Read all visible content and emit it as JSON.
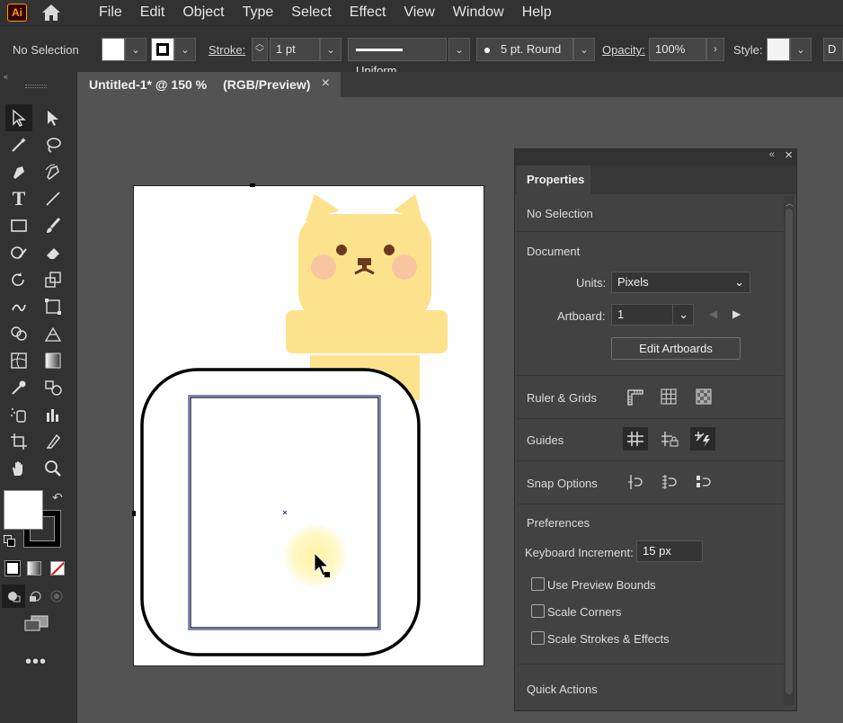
{
  "app": {
    "logo": "Ai"
  },
  "menu": [
    "File",
    "Edit",
    "Object",
    "Type",
    "Select",
    "Effect",
    "View",
    "Window",
    "Help"
  ],
  "control": {
    "selection": "No Selection",
    "stroke_label": "Stroke:",
    "stroke_weight": "1 pt",
    "profile": "Uniform",
    "brush": "5 pt. Round",
    "opacity_label": "Opacity:",
    "opacity_value": "100%",
    "style_label": "Style:",
    "doc_setup_initial": "D"
  },
  "document_tab": {
    "title": "Untitled-1* @ 150 %",
    "mode": "(RGB/Preview)",
    "close": "×"
  },
  "properties": {
    "tab": "Properties",
    "selection": "No Selection",
    "document_heading": "Document",
    "units_label": "Units:",
    "units_value": "Pixels",
    "artboard_label": "Artboard:",
    "artboard_value": "1",
    "edit_artboards": "Edit Artboards",
    "ruler_grids": "Ruler & Grids",
    "guides": "Guides",
    "snap_options": "Snap Options",
    "preferences": "Preferences",
    "keyboard_increment_label": "Keyboard Increment:",
    "keyboard_increment_value": "15 px",
    "use_preview_bounds": "Use Preview Bounds",
    "scale_corners": "Scale Corners",
    "scale_strokes": "Scale Strokes & Effects",
    "quick_actions": "Quick Actions"
  },
  "colors": {
    "bear_body": "#fde28e",
    "bear_cheek": "#f9c4a0",
    "bear_eye": "#6b3a1e",
    "frame_stroke": "#000000",
    "selection_blue": "#2b35a8",
    "cursor_highlight": "#fff7b0"
  }
}
